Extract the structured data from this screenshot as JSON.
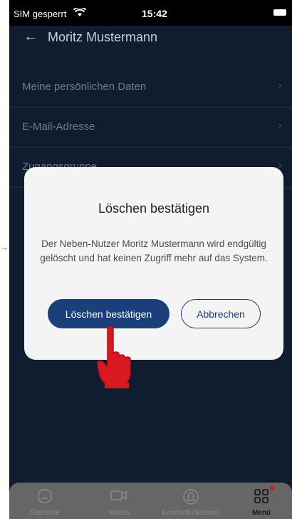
{
  "status_bar": {
    "carrier": "SIM gesperrt",
    "time": "15:42"
  },
  "header": {
    "back_icon": "back-arrow-icon",
    "title": "Moritz Mustermann"
  },
  "menu": {
    "items": [
      {
        "label": "Meine persönlichen Daten"
      },
      {
        "label": "E-Mail-Adresse"
      },
      {
        "label": "Zugangsgruppe"
      }
    ]
  },
  "dialog": {
    "title": "Löschen bestätigen",
    "message": "Der Neben-Nutzer Moritz Mustermann wird endgültig gelöscht und hat keinen Zugriff mehr auf das System.",
    "confirm_label": "Löschen bestätigen",
    "cancel_label": "Abbrechen"
  },
  "tabbar": {
    "tabs": [
      {
        "label": "Startseite",
        "icon": "home-icon"
      },
      {
        "label": "Videos",
        "icon": "video-camera-icon"
      },
      {
        "label": "Komfortfunktionen",
        "icon": "bell-icon"
      },
      {
        "label": "Menü",
        "icon": "grid-menu-icon",
        "active": true
      }
    ]
  },
  "colors": {
    "background": "#0f1d2e",
    "primary": "#1a3f7a",
    "dialog_bg": "#f4f4f4",
    "pointer": "#d81a20",
    "badge": "#d81a20"
  }
}
